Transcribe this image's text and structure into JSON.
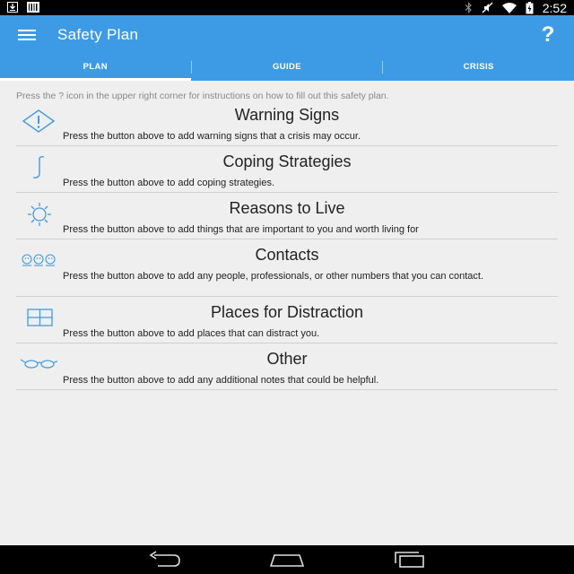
{
  "status_bar": {
    "time": "2:52"
  },
  "app_bar": {
    "title": "Safety Plan",
    "help_label": "?"
  },
  "tabs": [
    {
      "label": "PLAN",
      "active": true
    },
    {
      "label": "GUIDE",
      "active": false
    },
    {
      "label": "CRISIS",
      "active": false
    }
  ],
  "instructions": "Press the ? icon in the upper right corner for instructions on how to fill out this safety plan.",
  "sections": [
    {
      "title": "Warning Signs",
      "description": "Press the button above to add warning signs that a crisis may occur.",
      "icon": "warning-diamond-icon"
    },
    {
      "title": "Coping Strategies",
      "description": "Press the button above to add coping strategies.",
      "icon": "music-note-icon"
    },
    {
      "title": "Reasons to Live",
      "description": "Press the button above to add things that are important to you and worth living for",
      "icon": "sun-icon"
    },
    {
      "title": "Contacts",
      "description": "Press the button above to add any people, professionals, or other numbers that you can contact.",
      "icon": "people-icon"
    },
    {
      "title": "Places for Distraction",
      "description": "Press the button above to add places that can distract you.",
      "icon": "window-icon"
    },
    {
      "title": "Other",
      "description": "Press the button above to add any additional notes that could be helpful.",
      "icon": "glasses-icon"
    }
  ],
  "colors": {
    "accent": "#3d9be6",
    "icon": "#3d9be6",
    "background": "#efefef"
  }
}
